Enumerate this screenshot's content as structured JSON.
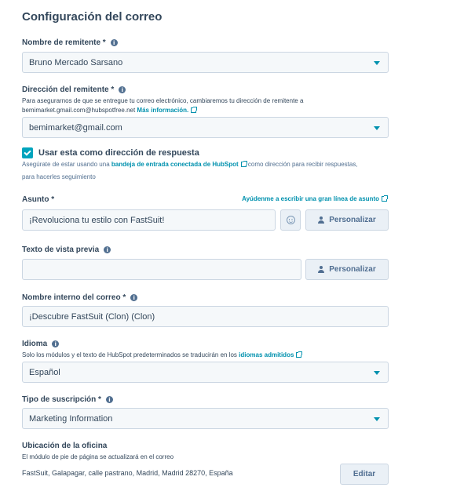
{
  "title": "Configuración del correo",
  "sender_name": {
    "label": "Nombre de remitente *",
    "value": "Bruno Mercado Sarsano"
  },
  "sender_address": {
    "label": "Dirección del remitente *",
    "help_line1": "Para asegurarnos de que se entregue tu correo electrónico, cambiaremos tu dirección de remitente a",
    "help_line2_prefix": "bemimarket.gmail.com@hubspotfree.net",
    "help_link": "Más información.",
    "value": "bemimarket@gmail.com"
  },
  "reply_to": {
    "checkbox_label": "Usar esta como dirección de respuesta",
    "checked": true,
    "help_prefix": "Asegúrate de estar usando una",
    "help_link": "bandeja de entrada conectada de HubSpot",
    "help_suffix": "como dirección para recibir respuestas,",
    "help_line2": "para hacerles seguimiento"
  },
  "subject": {
    "label": "Asunto *",
    "assist_link": "Ayúdenme a escribir una gran línea de asunto",
    "value": "¡Revoluciona tu estilo con FastSuit!",
    "personalize_label": "Personalizar"
  },
  "preview_text": {
    "label": "Texto de vista previa",
    "value": "",
    "personalize_label": "Personalizar"
  },
  "internal_name": {
    "label": "Nombre interno del correo *",
    "value": "¡Descubre FastSuit (Clon) (Clon)"
  },
  "language": {
    "label": "Idioma",
    "help_prefix": "Solo los módulos y el texto de HubSpot predeterminados se traducirán en los",
    "help_link": "idiomas admitidos",
    "value": "Español"
  },
  "subscription_type": {
    "label": "Tipo de suscripción *",
    "value": "Marketing Information"
  },
  "office_location": {
    "label": "Ubicación de la oficina",
    "help": "El módulo de pie de página se actualizará en el correo",
    "address": "FastSuit, Galapagar, calle pastrano, Madrid, Madrid 28270, España",
    "edit_label": "Editar"
  },
  "colors": {
    "accent": "#0091ae",
    "checkbox": "#00a4bd",
    "text": "#33475b",
    "field_bg": "#f5f8fa",
    "border": "#cbd6e2"
  }
}
